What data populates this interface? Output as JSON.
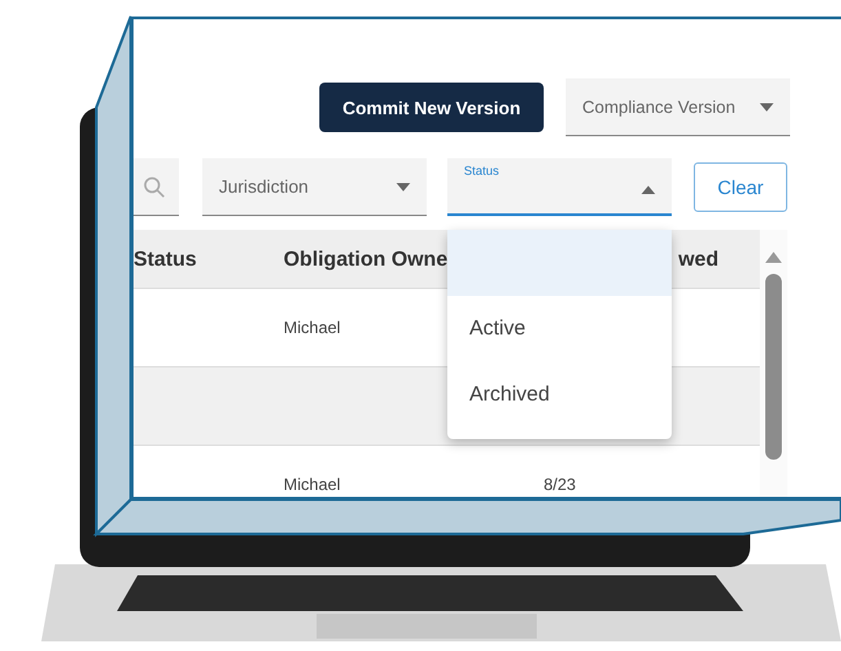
{
  "toolbar": {
    "commit_button": "Commit New Version",
    "version_select": {
      "placeholder": "Compliance Version"
    }
  },
  "filters": {
    "jurisdiction": {
      "placeholder": "Jurisdiction"
    },
    "status": {
      "label": "Status",
      "open": true
    },
    "clear_button": "Clear"
  },
  "table": {
    "columns": [
      "Status",
      "Obligation Owne",
      "wed"
    ],
    "rows": [
      {
        "column_2": "Michael",
        "striped": false
      },
      {
        "striped": true
      },
      {
        "column_2": "Michael",
        "column_3": "8/23",
        "striped": false
      }
    ]
  },
  "status_dropdown": {
    "blank_option_highlighted": true,
    "options": [
      {
        "label": "Active",
        "selected": false
      },
      {
        "label": "Archived",
        "selected": false
      }
    ]
  }
}
